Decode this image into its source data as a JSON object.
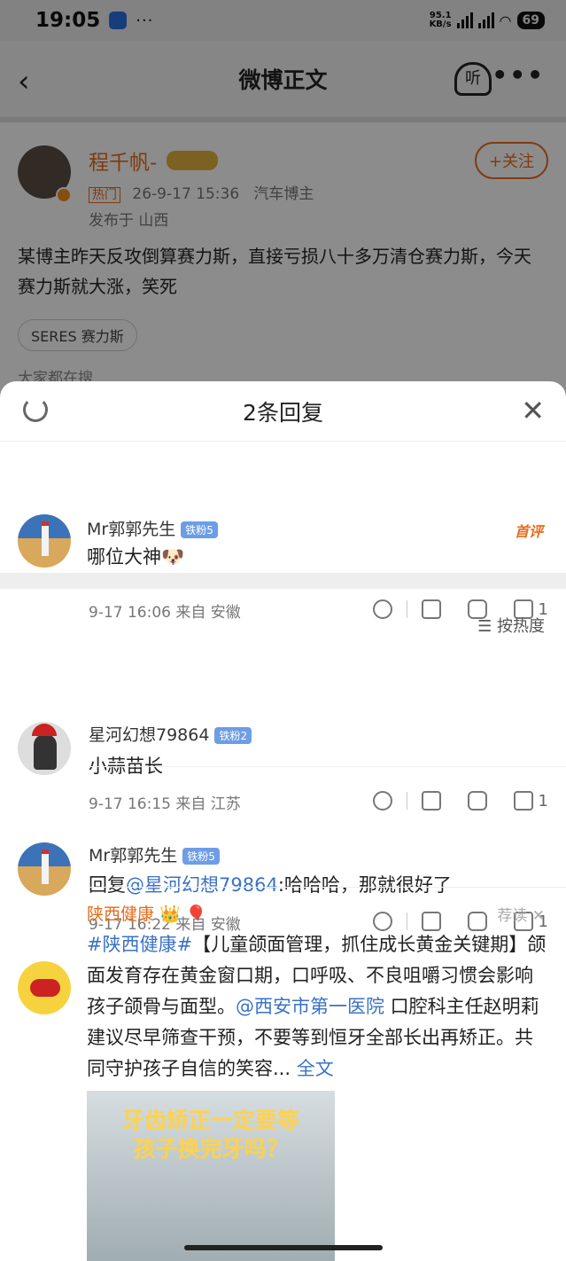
{
  "status_bar": {
    "time": "19:05",
    "dots": "···",
    "net_speed": "95.1",
    "net_unit": "KB/s",
    "battery": "69"
  },
  "nav": {
    "title": "微博正文",
    "back_icon": "chevron-left-icon",
    "listen_label": "听",
    "more_icon": "more-dots-icon"
  },
  "post": {
    "author": "程千帆-",
    "hot_tag": "热门",
    "timestamp": "26-9-17 15:36",
    "author_role": "汽车博主",
    "location": "发布于 山西",
    "follow_label": "+关注",
    "text": "某博主昨天反攻倒算赛力斯，直接亏损八十多万清仓赛力斯，今天赛力斯就大涨，笑死",
    "topic_chip": "SERES 赛力斯",
    "hint": "大家都在搜"
  },
  "sheet": {
    "title": "2条回复",
    "root_comment": {
      "user": "Mr郭郭先生",
      "fan_badge": "铁粉5",
      "text": "哪位大神🐶",
      "tag": "首评",
      "meta": "9-17 16:06  来自 安徽",
      "likes": "1"
    },
    "sort_label": "☰ 按热度",
    "replies": [
      {
        "user": "星河幻想79864",
        "fan_badge": "铁粉2",
        "text": "小蒜苗长",
        "meta": "9-17 16:15  来自 江苏",
        "likes": "1"
      },
      {
        "user": "Mr郭郭先生",
        "fan_badge": "铁粉5",
        "reply_prefix": "回复",
        "reply_at": "@星河幻想79864",
        "text": ":哈哈哈，那就很好了",
        "meta": "9-17 16:22  来自 安徽",
        "likes": "1"
      }
    ],
    "ad": {
      "name": "陕西健康 👑 🎈",
      "tag": "荐读 ✕",
      "hashtag": "#陕西健康#",
      "text1": "【儿童颌面管理，抓住成长黄金关键期】颌面发育存在黄金窗口期，口呼吸、不良咀嚼习惯会影响孩子颌骨与面型。",
      "mention": "@西安市第一医院",
      "text2": " 口腔科主任赵明莉建议尽早筛查干预，不要等到恒牙全部长出再矫正。共同守护孩子自信的笑容...",
      "full_text_link": "全文",
      "image_caption_1": "牙齿矫正一定要等",
      "image_caption_2": "孩子换完牙吗？"
    }
  }
}
